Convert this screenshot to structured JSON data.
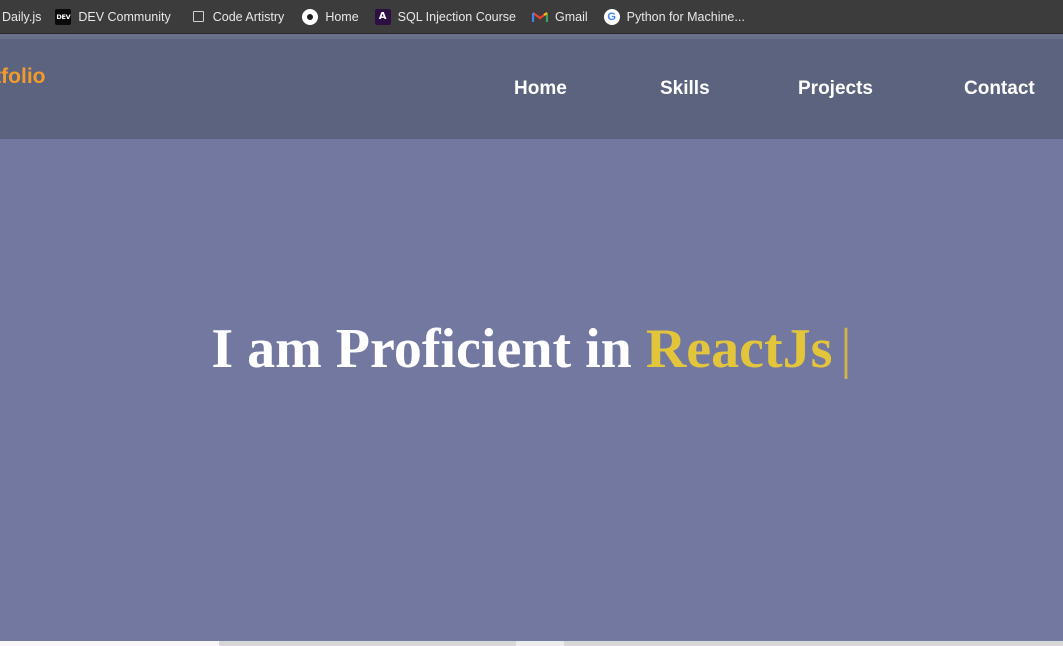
{
  "bookmarks": [
    {
      "label": "Daily.js",
      "icon": "none"
    },
    {
      "label": "DEV Community",
      "icon": "dev-icon",
      "icon_text": "DEV"
    },
    {
      "label": "Code Artistry",
      "icon": "square-icon"
    },
    {
      "label": "Home",
      "icon": "home-circle-icon"
    },
    {
      "label": "SQL Injection Course",
      "icon": "a-logo-icon",
      "icon_text": "A"
    },
    {
      "label": "Gmail",
      "icon": "gmail-icon"
    },
    {
      "label": "Python for Machine...",
      "icon": "google-icon",
      "icon_text": "G"
    }
  ],
  "nav": {
    "logo": "rtfolio",
    "links": [
      "Home",
      "Skills",
      "Projects",
      "Contact"
    ]
  },
  "hero": {
    "static_text": "I am Proficient in",
    "typed_text": "ReactJs",
    "cursor": "|"
  },
  "colors": {
    "bookmarks_bg": "#3c3c3c",
    "nav_bg": "#5b637f",
    "hero_bg": "#7278a0",
    "logo": "#f39a2c",
    "typed_accent": "#e3c53c"
  }
}
